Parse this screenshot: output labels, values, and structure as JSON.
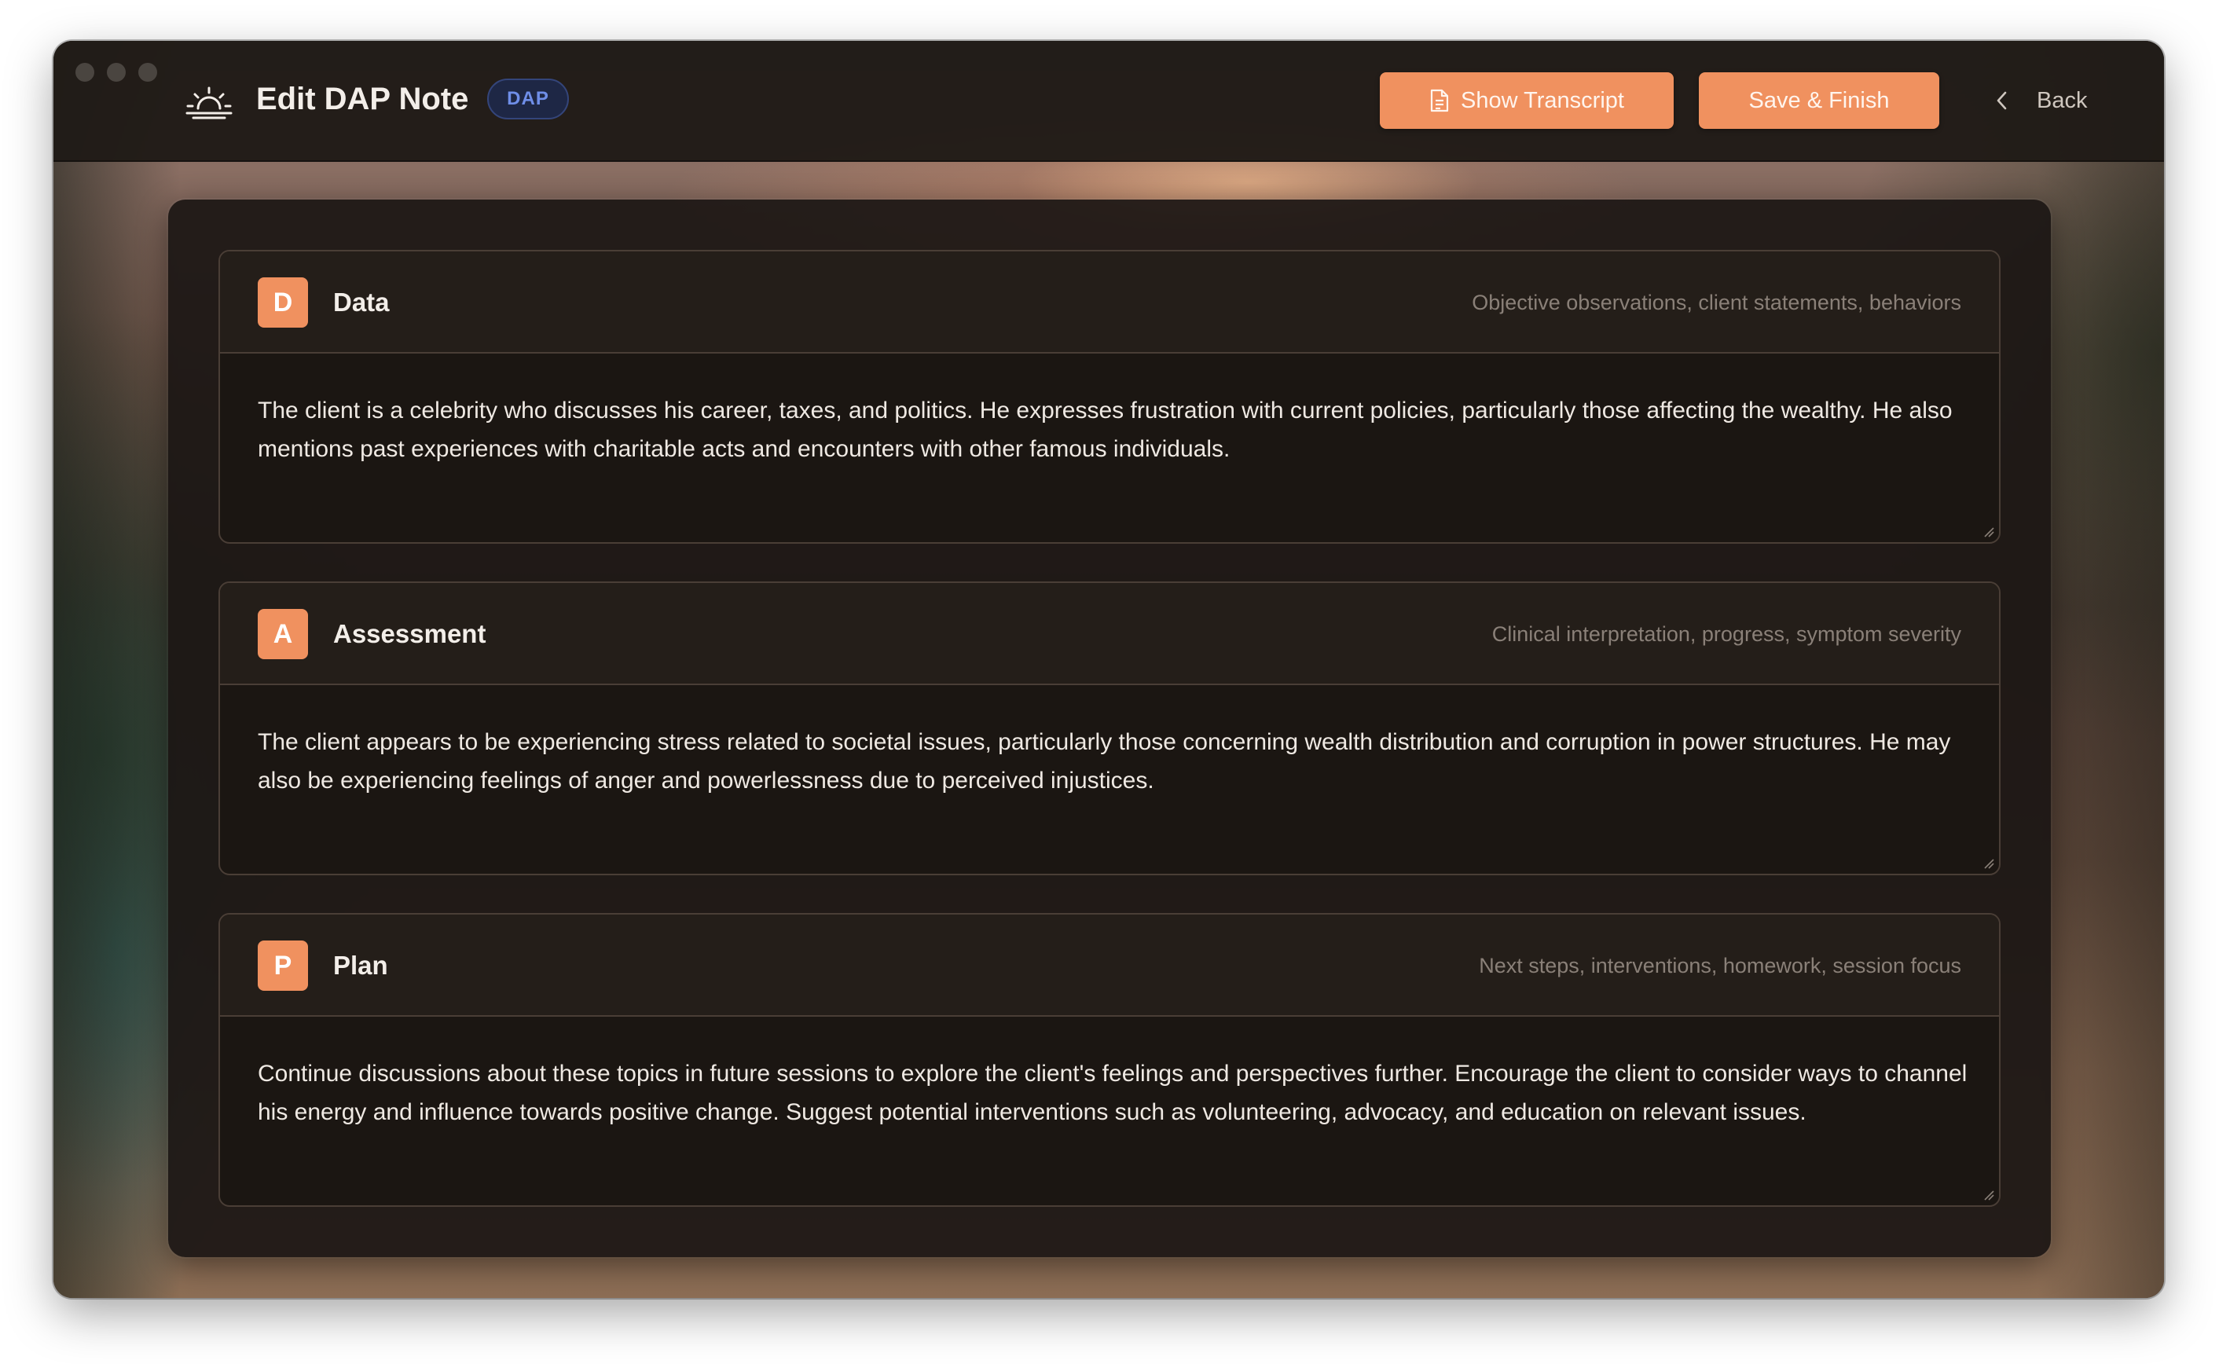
{
  "window": {
    "title": "Edit DAP Note",
    "badge": "DAP"
  },
  "toolbar": {
    "show_transcript_label": "Show Transcript",
    "save_finish_label": "Save & Finish",
    "back_label": "Back"
  },
  "colors": {
    "accent": "#f0915f",
    "badge_text": "#6f8ee8",
    "panel": "#1b1612"
  },
  "icons": {
    "logo": "sunrise-icon",
    "transcript": "document-icon",
    "back": "chevron-left-icon"
  },
  "sections": [
    {
      "letter": "D",
      "title": "Data",
      "hint": "Objective observations, client statements, behaviors",
      "body": "The client is a celebrity who discusses his career, taxes, and politics. He expresses frustration with current policies, particularly those affecting the wealthy. He also mentions past experiences with charitable acts and encounters with other famous individuals."
    },
    {
      "letter": "A",
      "title": "Assessment",
      "hint": "Clinical interpretation, progress, symptom severity",
      "body": "The client appears to be experiencing stress related to societal issues, particularly those concerning wealth distribution and corruption in power structures. He may also be experiencing feelings of anger and powerlessness due to perceived injustices."
    },
    {
      "letter": "P",
      "title": "Plan",
      "hint": "Next steps, interventions, homework, session focus",
      "body": "Continue discussions about these topics in future sessions to explore the client's feelings and perspectives further. Encourage the client to consider ways to channel his energy and influence towards positive change. Suggest potential interventions such as volunteering, advocacy, and education on relevant issues."
    }
  ]
}
